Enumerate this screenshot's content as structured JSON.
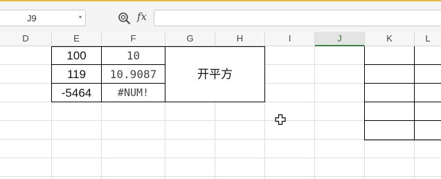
{
  "formula_bar": {
    "cell_reference": "J9",
    "dropdown_icon": "chevron-down-icon",
    "zoom_icon": "magnifier-zoom-icon",
    "fx_label": "fx",
    "formula_value": ""
  },
  "columns": {
    "d": "D",
    "e": "E",
    "f": "F",
    "g": "G",
    "h": "H",
    "i": "I",
    "j": "J",
    "k": "K",
    "l": "L"
  },
  "active_column": "J",
  "cells": {
    "e1": "100",
    "f1": "10",
    "e2": "119",
    "f2": "10.9087",
    "e3": "-5464",
    "f3": "#NUM!",
    "g_merged": "开平方"
  },
  "colors": {
    "active_column_accent": "#2e8b3d",
    "top_accent": "#e8b93a"
  },
  "cursor_icon": "cell-select-cross-cursor-icon"
}
